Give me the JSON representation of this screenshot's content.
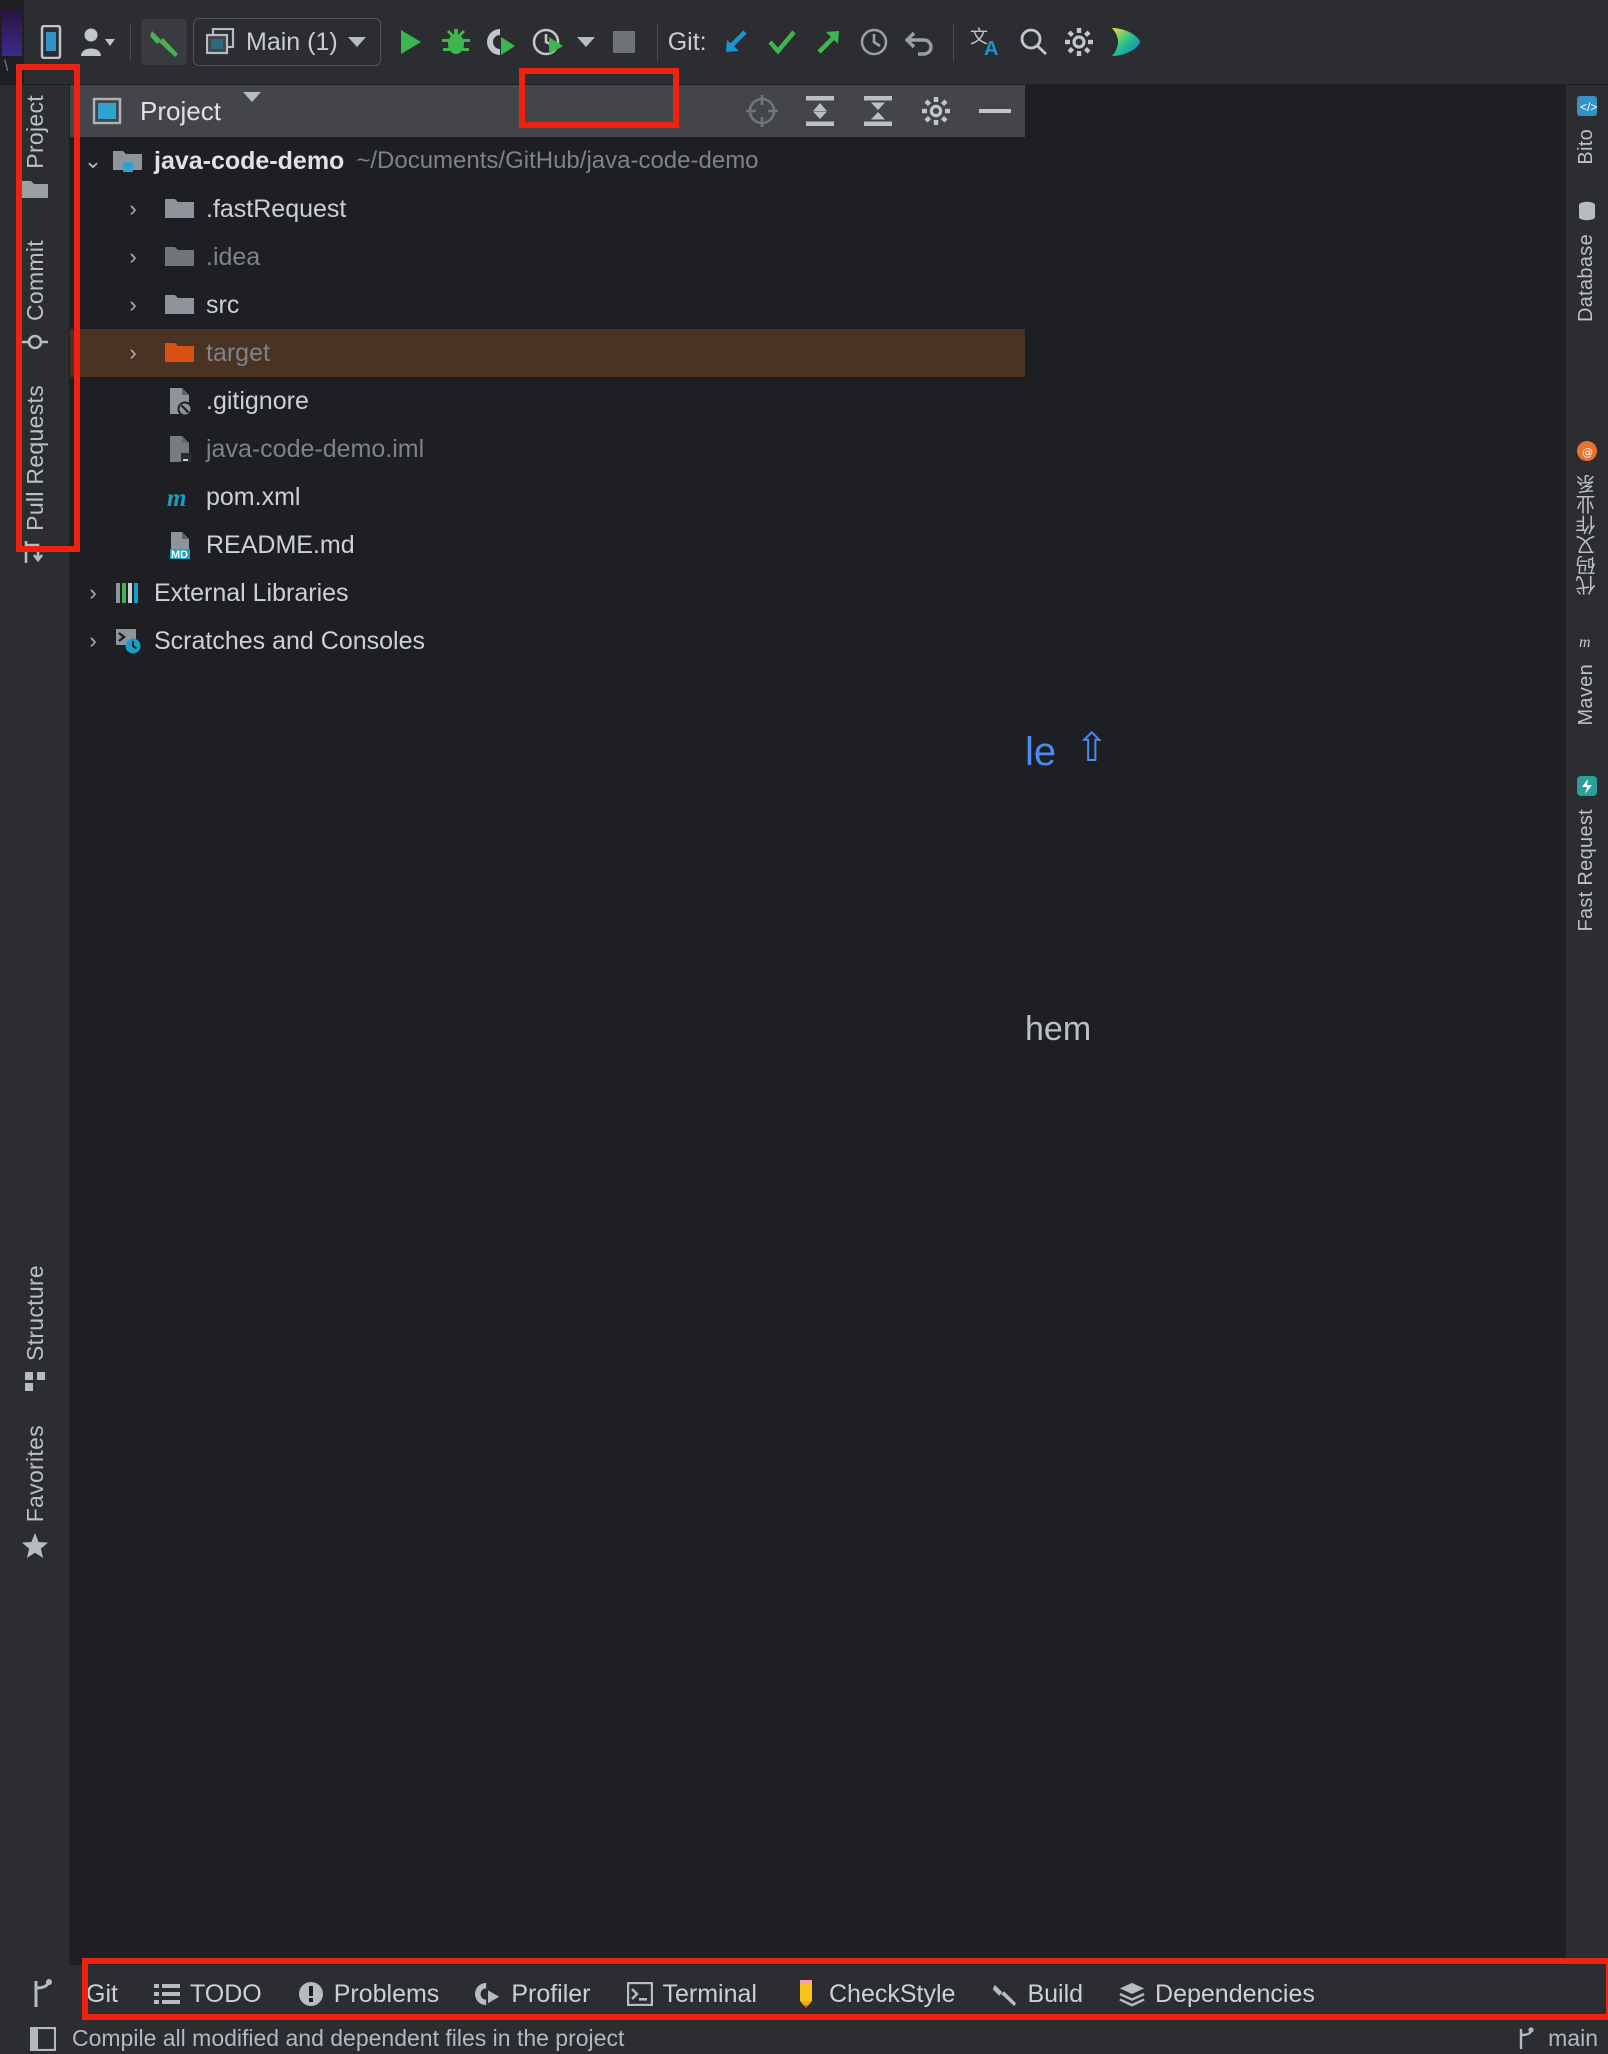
{
  "window": {
    "theme_bg": "#2b2d30",
    "panel_bg": "#1e1f22",
    "accent": "#4a8bf0",
    "annotation_color": "#ee2211"
  },
  "toolbar": {
    "icons": [
      {
        "name": "project-widget-icon",
        "glyph": "phone"
      },
      {
        "name": "account-icon",
        "glyph": "person"
      },
      {
        "name": "build-hammer-icon",
        "glyph": "hammer"
      }
    ],
    "run_config": {
      "label": "Main (1)",
      "dropdown": "▼"
    },
    "run_label": "Run",
    "debug_label": "Debug",
    "run_coverage_label": "Run with Coverage",
    "profile_label": "Profile",
    "stop_label": "Stop",
    "git_label": "Git:",
    "git_update_label": "Update Project",
    "git_commit_label": "Commit",
    "git_push_label": "Push",
    "git_history_label": "History",
    "git_rollback_label": "Rollback",
    "translate_label": "Translate",
    "search_label": "Search Everywhere",
    "settings_label": "Settings"
  },
  "left_tool_strip": {
    "items": [
      {
        "label": "Project",
        "icon": "folder-icon"
      },
      {
        "label": "Commit",
        "icon": "commit-icon"
      },
      {
        "label": "Pull Requests",
        "icon": "pull-request-icon"
      },
      {
        "label": "Structure",
        "icon": "structure-icon"
      },
      {
        "label": "Favorites",
        "icon": "star-icon"
      }
    ]
  },
  "project_panel": {
    "title": "Project",
    "dropdown": "▼",
    "toolbar_buttons": [
      {
        "label": "Select Opened File",
        "icon": "crosshair-icon"
      },
      {
        "label": "Expand All",
        "icon": "expand-all-icon"
      },
      {
        "label": "Collapse All",
        "icon": "collapse-all-icon"
      },
      {
        "label": "Options",
        "icon": "gear-icon"
      },
      {
        "label": "Hide",
        "icon": "minimize-icon"
      }
    ],
    "tree": [
      {
        "label": "java-code-demo",
        "path": "~/Documents/GitHub/java-code-demo",
        "icon": "module-folder-icon",
        "indent": 0,
        "arrow": "expanded",
        "style": "bold",
        "selected": false
      },
      {
        "label": ".fastRequest",
        "icon": "folder-icon",
        "indent": 1,
        "arrow": "collapsed",
        "style": "normal",
        "selected": false
      },
      {
        "label": ".idea",
        "icon": "folder-icon",
        "indent": 1,
        "arrow": "collapsed",
        "style": "dim",
        "selected": false
      },
      {
        "label": "src",
        "icon": "folder-icon",
        "indent": 1,
        "arrow": "collapsed",
        "style": "normal",
        "selected": false
      },
      {
        "label": "target",
        "icon": "folder-excluded-icon",
        "indent": 1,
        "arrow": "collapsed",
        "style": "dim",
        "selected": true
      },
      {
        "label": ".gitignore",
        "icon": "gitignore-file-icon",
        "indent": 1,
        "arrow": "none",
        "style": "normal",
        "selected": false
      },
      {
        "label": "java-code-demo.iml",
        "icon": "iml-file-icon",
        "indent": 1,
        "arrow": "none",
        "style": "dim",
        "selected": false
      },
      {
        "label": "pom.xml",
        "icon": "maven-file-icon",
        "indent": 1,
        "arrow": "none",
        "style": "normal",
        "selected": false
      },
      {
        "label": "README.md",
        "icon": "markdown-file-icon",
        "indent": 1,
        "arrow": "none",
        "style": "normal",
        "selected": false
      },
      {
        "label": "External Libraries",
        "icon": "libraries-icon",
        "indent": 0,
        "arrow": "collapsed",
        "style": "normal",
        "selected": false
      },
      {
        "label": "Scratches and Consoles",
        "icon": "scratches-icon",
        "indent": 0,
        "arrow": "collapsed",
        "style": "normal",
        "selected": false
      }
    ]
  },
  "editor": {
    "fragment_link": "le",
    "fragment_link_arrow": "⇧",
    "fragment_text": "hem"
  },
  "right_tool_strip": {
    "items": [
      {
        "label": "Bito",
        "icon": "bito-icon"
      },
      {
        "label": "Database",
        "icon": "database-icon"
      },
      {
        "label": "代码又作业系",
        "icon": "plugin-icon"
      },
      {
        "label": "Maven",
        "icon": "maven-icon"
      },
      {
        "label": "Fast Request",
        "icon": "fast-request-icon"
      }
    ]
  },
  "bottom_bar": {
    "items": [
      {
        "label": "Git",
        "icon": "git-branch-icon"
      },
      {
        "label": "TODO",
        "icon": "todo-list-icon"
      },
      {
        "label": "Problems",
        "icon": "problems-icon"
      },
      {
        "label": "Profiler",
        "icon": "profiler-icon"
      },
      {
        "label": "Terminal",
        "icon": "terminal-icon"
      },
      {
        "label": "CheckStyle",
        "icon": "checkstyle-pencil-icon"
      },
      {
        "label": "Build",
        "icon": "build-hammer-icon"
      },
      {
        "label": "Dependencies",
        "icon": "dependencies-icon"
      }
    ]
  },
  "status_bar": {
    "message": "Compile all modified and dependent files in the project",
    "branch": "main",
    "branch_icon": "git-branch-icon"
  }
}
